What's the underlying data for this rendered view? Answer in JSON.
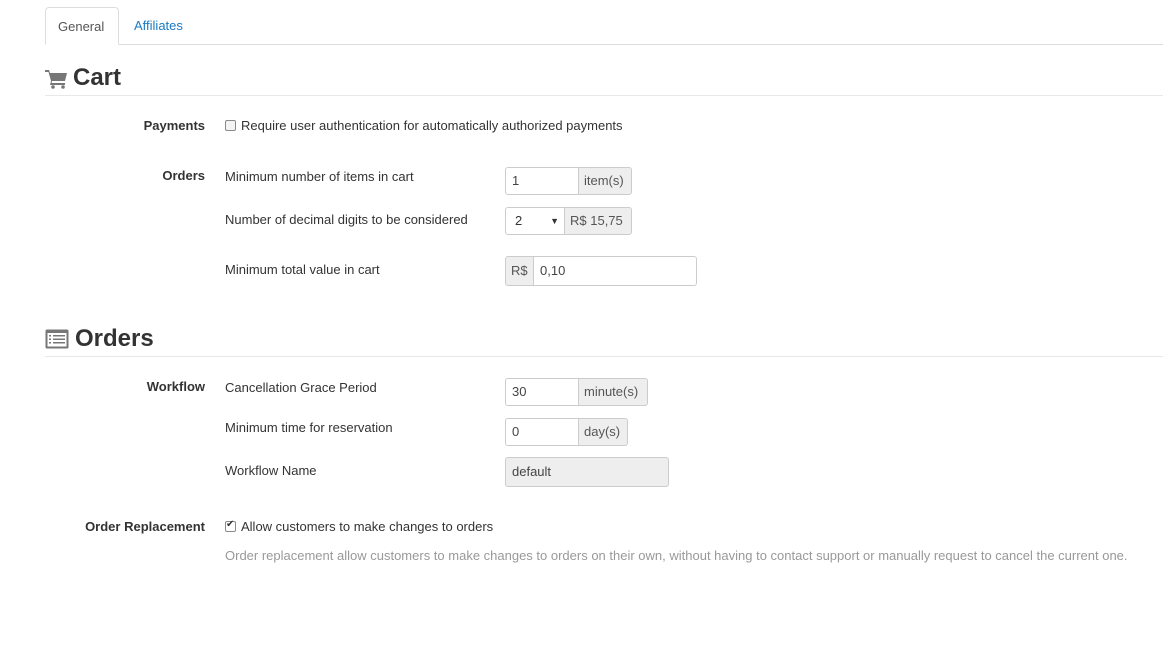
{
  "tabs": {
    "general": "General",
    "affiliates": "Affiliates"
  },
  "cart": {
    "title": "Cart",
    "payments_label": "Payments",
    "payments_checkbox": "Require user authentication for automatically authorized payments",
    "orders_label": "Orders",
    "min_items_label": "Minimum number of items in cart",
    "min_items_value": "1",
    "min_items_unit": "item(s)",
    "decimal_label": "Number of decimal digits to be considered",
    "decimal_value": "2",
    "decimal_example": "R$ 15,75",
    "min_total_label": "Minimum total value in cart",
    "min_total_currency": "R$",
    "min_total_value": "0,10"
  },
  "orders": {
    "title": "Orders",
    "workflow_label": "Workflow",
    "grace_label": "Cancellation Grace Period",
    "grace_value": "30",
    "grace_unit": "minute(s)",
    "reservation_label": "Minimum time for reservation",
    "reservation_value": "0",
    "reservation_unit": "day(s)",
    "workflow_name_label": "Workflow Name",
    "workflow_name_value": "default",
    "replacement_label": "Order Replacement",
    "replacement_checkbox": "Allow customers to make changes to orders",
    "replacement_checked": true,
    "replacement_help": "Order replacement allow customers to make changes to orders on their own, without having to contact support or manually request to cancel the current one."
  }
}
